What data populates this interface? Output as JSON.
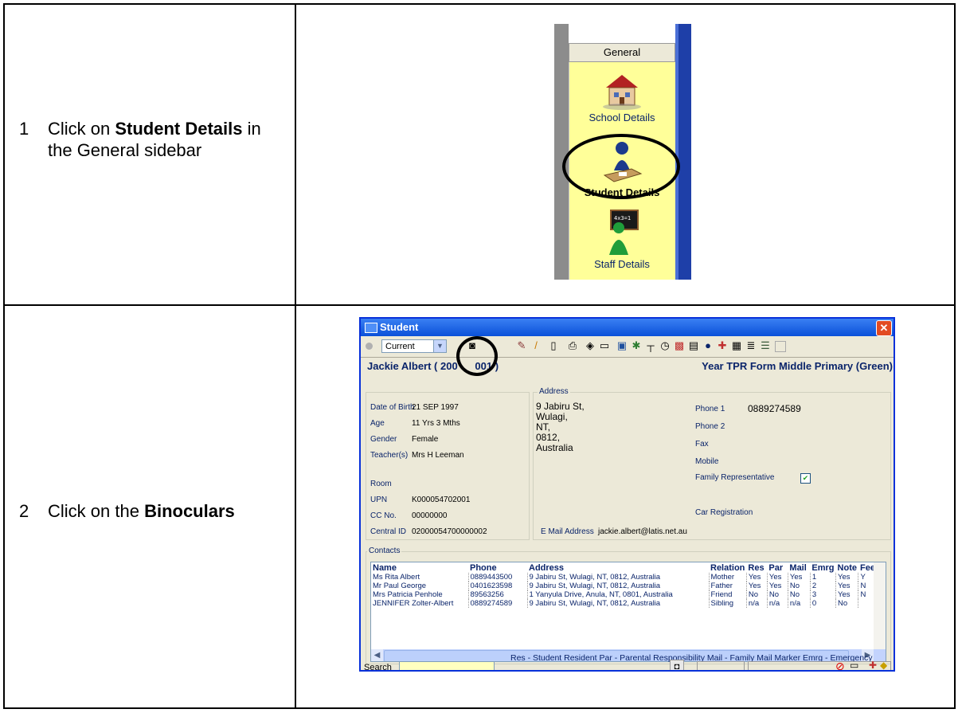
{
  "steps": [
    {
      "num": "1",
      "pre": "Click on ",
      "bold": "Student Details",
      "post": "  in the General sidebar"
    },
    {
      "num": "2",
      "pre": "Click on the ",
      "bold": "Binoculars",
      "post": ""
    }
  ],
  "sidebar": {
    "header": "General",
    "items": [
      {
        "label": "School Details",
        "icon": "school-icon"
      },
      {
        "label": "Student Details",
        "icon": "student-icon"
      },
      {
        "label": "Staff Details",
        "icon": "staff-icon"
      }
    ]
  },
  "window": {
    "title": "Student",
    "filter_value": "Current",
    "student_name": "Jackie Albert  ( 200",
    "student_name_tail": "001 )",
    "student_year": "Year TPR  Form Middle Primary (Green)",
    "details": [
      {
        "label": "Date of Birth",
        "value": "21 SEP 1997"
      },
      {
        "label": "Age",
        "value": "11 Yrs 3 Mths"
      },
      {
        "label": "Gender",
        "value": "Female"
      },
      {
        "label": "Teacher(s)",
        "value": "Mrs H Leeman"
      },
      {
        "label": "Room",
        "value": ""
      },
      {
        "label": "UPN",
        "value": "K000054702001"
      },
      {
        "label": "CC No.",
        "value": "00000000"
      },
      {
        "label": "Central ID",
        "value": "02000054700000002"
      }
    ],
    "address_title": "Address",
    "address_lines": [
      "9 Jabiru St,",
      "Wulagi,",
      "NT,",
      "0812,",
      "Australia"
    ],
    "phone1_label": "Phone 1",
    "phone1_value": "0889274589",
    "phone2_label": "Phone 2",
    "fax_label": "Fax",
    "mobile_label": "Mobile",
    "family_rep_label": "Family Representative",
    "car_label": "Car Registration",
    "email_label": "E Mail Address",
    "email_value": "jackie.albert@latis.net.au",
    "contacts_title": "Contacts",
    "contacts_headers": [
      "Name",
      "Phone",
      "Address",
      "Relation",
      "Res",
      "Par",
      "Mail",
      "Emrg",
      "Note",
      "Fee"
    ],
    "contacts_rows": [
      [
        "Ms Rita Albert",
        "0889443500",
        "9 Jabiru St, Wulagi, NT, 0812, Australia",
        "Mother",
        "Yes",
        "Yes",
        "Yes",
        "1",
        "Yes",
        "Y"
      ],
      [
        "Mr Paul George",
        "0401623598",
        "9 Jabiru St, Wulagi, NT, 0812, Australia",
        "Father",
        "Yes",
        "Yes",
        "No",
        "2",
        "Yes",
        "N"
      ],
      [
        "Mrs Patricia Penhole",
        "89563256",
        "1 Yanyula Drive, Anula, NT, 0801, Australia",
        "Friend",
        "No",
        "No",
        "No",
        "3",
        "Yes",
        "N"
      ],
      [
        " JENNIFER Zolter-Albert",
        "0889274589",
        "9 Jabiru St, Wulagi, NT, 0812, Australia",
        "Sibling",
        "n/a",
        "n/a",
        "n/a",
        "0",
        "No",
        ""
      ]
    ],
    "legend": "Res - Student Resident   Par - Parental Responsibility   Mail - Family Mail Marker   Emrg - Emergency",
    "search_label": "Search"
  }
}
